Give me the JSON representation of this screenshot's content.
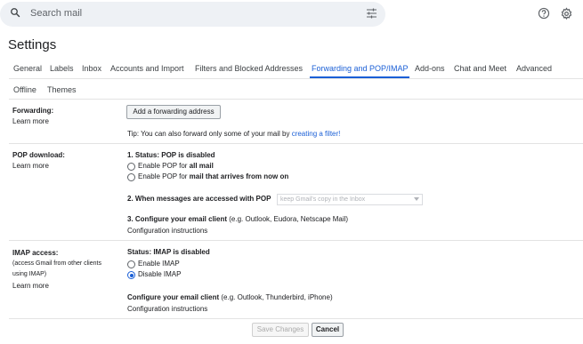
{
  "header": {
    "search_placeholder": "Search mail"
  },
  "page_title": "Settings",
  "tabs": [
    {
      "label": "General"
    },
    {
      "label": "Labels"
    },
    {
      "label": "Inbox"
    },
    {
      "label": "Accounts and Import"
    },
    {
      "label": "Filters and Blocked Addresses"
    },
    {
      "label": "Forwarding and POP/IMAP"
    },
    {
      "label": "Add-ons"
    },
    {
      "label": "Chat and Meet"
    },
    {
      "label": "Advanced"
    },
    {
      "label": "Offline"
    },
    {
      "label": "Themes"
    }
  ],
  "active_tab": "Forwarding and POP/IMAP",
  "forwarding": {
    "label": "Forwarding:",
    "learn_more": "Learn more",
    "add_button": "Add a forwarding address",
    "tip_prefix": "Tip: You can also forward only some of your mail by ",
    "tip_link": "creating a filter!"
  },
  "pop": {
    "label": "POP download:",
    "learn_more": "Learn more",
    "status": "1. Status: POP is disabled",
    "option1_prefix": "Enable POP for ",
    "option1_bold": "all mail",
    "option2_prefix": "Enable POP for ",
    "option2_bold": "mail that arrives from now on",
    "access_label": "2. When messages are accessed with POP",
    "access_select": "keep Gmail's copy in the Inbox",
    "configure_bold": "3. Configure your email client",
    "configure_rest": " (e.g. Outlook, Eudora, Netscape Mail)",
    "instructions": "Configuration instructions"
  },
  "imap": {
    "label": "IMAP access:",
    "sub1": "(access Gmail from other clients",
    "sub2": "using IMAP)",
    "learn_more": "Learn more",
    "status": "Status: IMAP is disabled",
    "enable": "Enable IMAP",
    "disable": "Disable IMAP",
    "selected": "Disable IMAP",
    "configure_bold": "Configure your email client",
    "configure_rest": " (e.g. Outlook, Thunderbird, iPhone)",
    "instructions": "Configuration instructions"
  },
  "footer": {
    "save": "Save Changes",
    "cancel": "Cancel"
  },
  "colors": {
    "accent": "#1a5fd6",
    "search_bg": "#eef1f5"
  }
}
